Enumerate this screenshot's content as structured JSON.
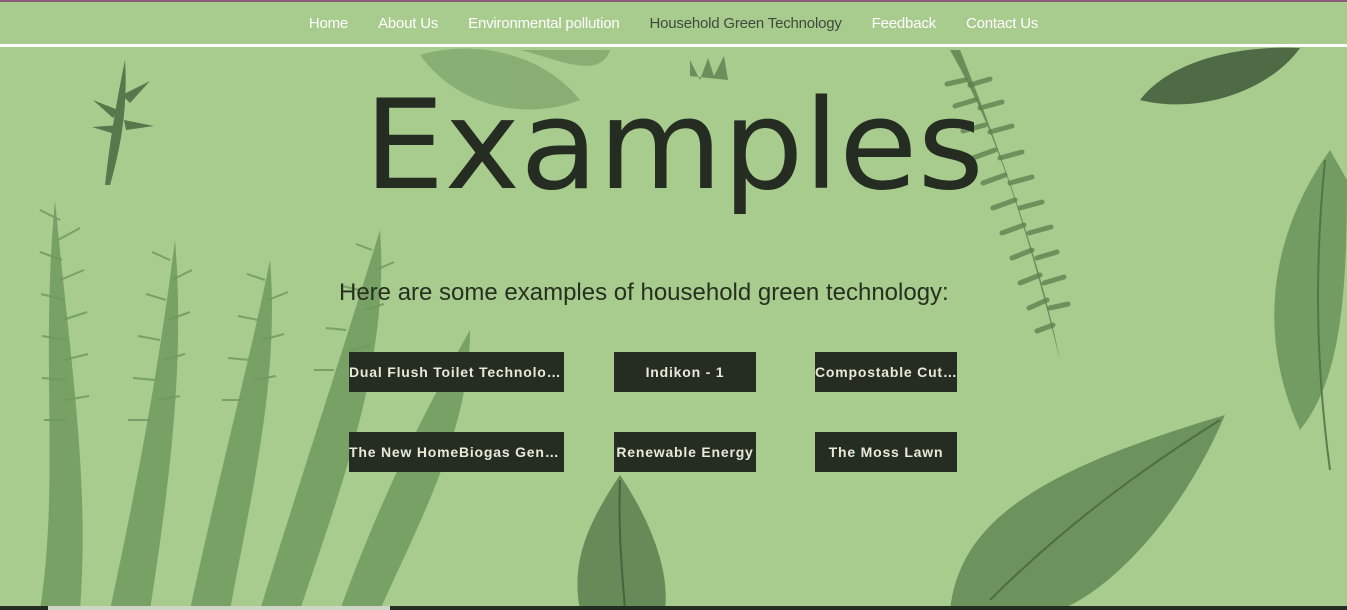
{
  "nav": {
    "items": [
      {
        "label": "Home",
        "active": false
      },
      {
        "label": "About Us",
        "active": false
      },
      {
        "label": "Environmental pollution",
        "active": false
      },
      {
        "label": "Household Green Technology",
        "active": true
      },
      {
        "label": "Feedback",
        "active": false
      },
      {
        "label": "Contact Us",
        "active": false
      }
    ]
  },
  "main": {
    "title": "Examples",
    "subtitle": "Here are some examples of household green technology:",
    "buttons": [
      {
        "label": "Dual Flush Toilet Technology"
      },
      {
        "label": "Indikon - 1"
      },
      {
        "label": "Compostable Cutlery"
      },
      {
        "label": "The New HomeBiogas Generator"
      },
      {
        "label": "Renewable Energy"
      },
      {
        "label": "The Moss Lawn"
      }
    ]
  },
  "colors": {
    "background": "#a8cb8e",
    "button_bg": "#252c22",
    "button_text": "#e6ebd9",
    "nav_text": "#ffffff",
    "nav_active": "#3f4a3a",
    "title": "#252c22"
  }
}
